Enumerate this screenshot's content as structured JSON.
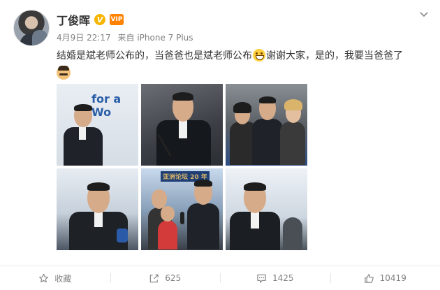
{
  "post": {
    "username": "丁俊晖",
    "verified_badge": "V",
    "member_badge": "VIP",
    "date": "4月9日 22:17",
    "source": "来自 iPhone 7 Plus",
    "text_part1": "结婚是斌老师公布的，当爸爸也是斌老师公布",
    "text_part2": "谢谢大家，是的，我要当爸爸了",
    "emoji_1": "grin-emoji",
    "emoji_2": "mustache-emoji"
  },
  "photos": {
    "p1_text": "for a Wo",
    "p5_text": "亚洲论坛 20 年"
  },
  "actions": {
    "favorite_label": "收藏",
    "repost_count": "625",
    "comment_count": "1425",
    "like_count": "10419"
  },
  "icons": {
    "favorite": "star-icon",
    "repost": "share-icon",
    "comment": "comment-icon",
    "like": "thumbs-up-icon",
    "menu": "chevron-down-icon"
  },
  "colors": {
    "text": "#333333",
    "meta": "#808080",
    "verified": "#f7b500",
    "member": "#ff8200"
  }
}
